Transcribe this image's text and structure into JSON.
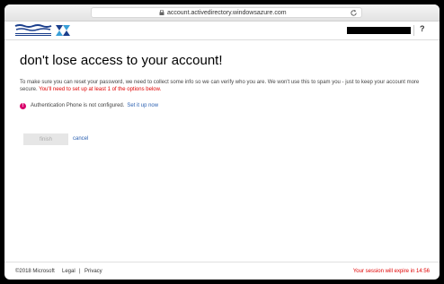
{
  "browser": {
    "url": "account.activedirectory.windowsazure.com"
  },
  "header": {
    "help_label": "?"
  },
  "main": {
    "title": "don't lose access to your account!",
    "description": "To make sure you can reset your password, we need to collect some info so we can verify who you are. We won't use this to spam you - just to keep your account more secure.",
    "requirement": "You'll need to set up at least 1 of the options below.",
    "notice_text": "Authentication Phone is not configured.",
    "setup_link": "Set it up now",
    "finish_label": "finish",
    "cancel_label": "cancel"
  },
  "footer": {
    "copyright": "©2018 Microsoft",
    "legal": "Legal",
    "separator": "|",
    "privacy": "Privacy",
    "session": "Your session will expire in 14:56"
  },
  "colors": {
    "link": "#2a5fb0",
    "warning": "#e00000",
    "alert_icon": "#d9006c"
  }
}
